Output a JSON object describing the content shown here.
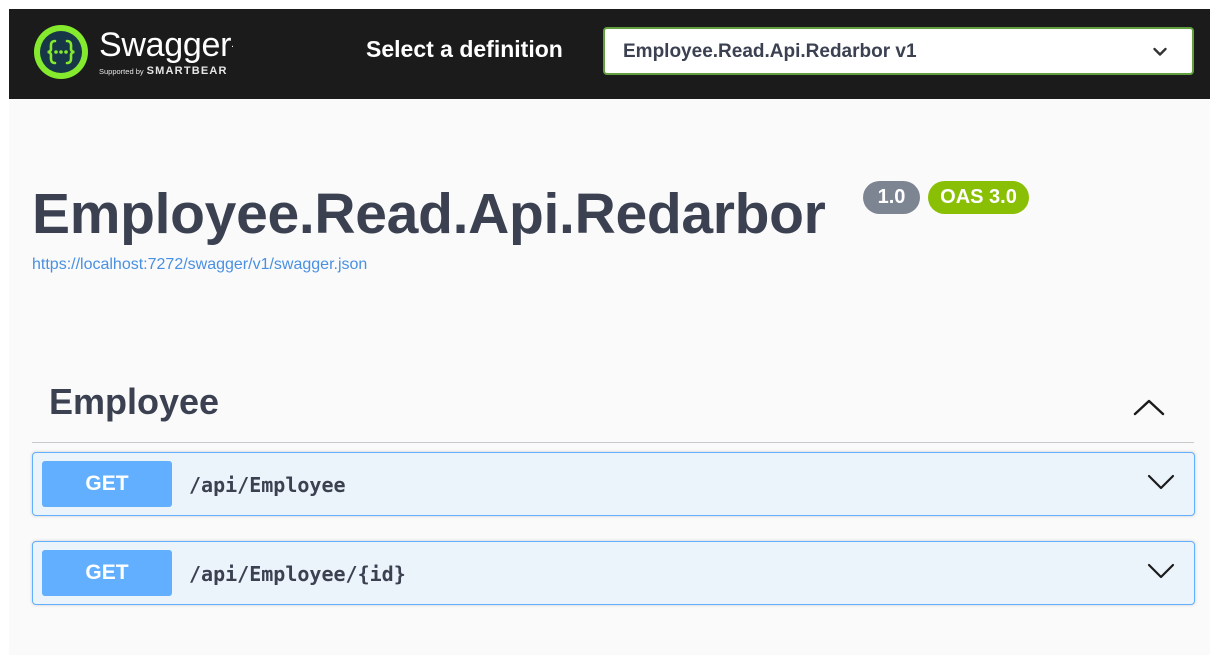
{
  "topbar": {
    "logo": {
      "icon": "swagger-braces-icon",
      "name": "Swagger",
      "trademark": ".",
      "supported_by": "Supported by",
      "brand": "SMARTBEAR"
    },
    "select_label": "Select a definition",
    "select_value": "Employee.Read.Api.Redarbor v1",
    "select_icon": "chevron-down-icon"
  },
  "info": {
    "title": "Employee.Read.Api.Redarbor",
    "version_badge": "1.0",
    "oas_badge": "OAS 3.0",
    "spec_url": "https://localhost:7272/swagger/v1/swagger.json"
  },
  "tags": [
    {
      "name": "Employee",
      "expanded": true,
      "toggle_icon": "chevron-up-icon",
      "operations": [
        {
          "method": "GET",
          "path": "/api/Employee",
          "icon": "chevron-down-icon"
        },
        {
          "method": "GET",
          "path": "/api/Employee/{id}",
          "icon": "chevron-down-icon"
        }
      ]
    }
  ],
  "colors": {
    "topbar_bg": "#1b1b1b",
    "logo_green": "#85ea2d",
    "select_border": "#62a03f",
    "version_badge": "#7d8492",
    "oas_badge": "#89bf04",
    "get_method": "#61affe",
    "get_block_bg": "#ebf3fb",
    "link": "#4990e2"
  }
}
